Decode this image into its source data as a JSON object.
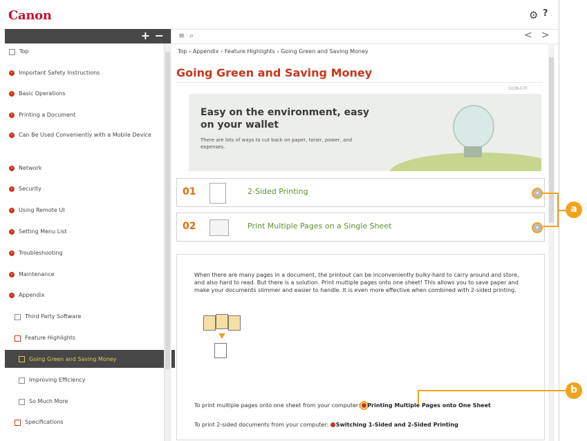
{
  "app": {
    "logo": "Canon",
    "help": "?"
  },
  "icons": {
    "gear": "gear-icon",
    "help": "help-icon",
    "list": "list-icon",
    "search": "search-icon",
    "prev": "chevron-left-icon",
    "next": "chevron-right-icon"
  },
  "sidebar": {
    "expand_label": "+",
    "collapse_label": "−",
    "items": [
      {
        "label": "Top",
        "icon": "square"
      },
      {
        "label": "Important Safety Instructions",
        "icon": "dot"
      },
      {
        "label": "Basic Operations",
        "icon": "dot"
      },
      {
        "label": "Printing a Document",
        "icon": "dot"
      },
      {
        "label": "Can Be Used Conveniently with a Mobile Device",
        "icon": "dot"
      },
      {
        "label": "Network",
        "icon": "dot"
      },
      {
        "label": "Security",
        "icon": "dot"
      },
      {
        "label": "Using Remote UI",
        "icon": "dot"
      },
      {
        "label": "Setting Menu List",
        "icon": "dot"
      },
      {
        "label": "Troubleshooting",
        "icon": "dot"
      },
      {
        "label": "Maintenance",
        "icon": "dot"
      },
      {
        "label": "Appendix",
        "icon": "dot"
      },
      {
        "label": "Third Party Software",
        "icon": "square"
      },
      {
        "label": "Feature Highlights",
        "icon": "square"
      },
      {
        "label": "Going Green and Saving Money",
        "icon": "square"
      },
      {
        "label": "Improving Efficiency",
        "icon": "square"
      },
      {
        "label": "So Much More",
        "icon": "square"
      },
      {
        "label": "Specifications",
        "icon": "square"
      }
    ]
  },
  "toolbar": {
    "list_glyph": "≡",
    "search_glyph": "⌕",
    "prev_glyph": "<",
    "next_glyph": ">"
  },
  "breadcrumb": "Top › Appendix › Feature Highlights › Going Green and Saving Money",
  "page": {
    "title": "Going Green and Saving Money",
    "code": "103K-07F",
    "banner_heading": "Easy on the environment, easy on your wallet",
    "banner_text": "There are lots of ways to cut back on paper, toner, power, and expenses.",
    "features": [
      {
        "num": "01",
        "label": "2-Sided Printing"
      },
      {
        "num": "02",
        "label": "Print Multiple Pages on a Single Sheet"
      }
    ],
    "toggle_glyph": "▾",
    "body": "When there are many pages in a document, the printout can be inconveniently bulky-hard to carry around and store, and also hard to read. But there is a solution. Print multiple pages onto one sheet! This allows you to save paper and make your documents slimmer and easier to handle. It is even more effective when combined with 2-sided printing.",
    "link1_prefix": "To print multiple pages onto one sheet from your computer: ",
    "link1": "Printing Multiple Pages onto One Sheet",
    "link2_prefix": "To print 2-sided documents from your computer: ",
    "link2": "Switching 1-Sided and 2-Sided Printing"
  },
  "callouts": {
    "a": "a",
    "b": "b"
  }
}
